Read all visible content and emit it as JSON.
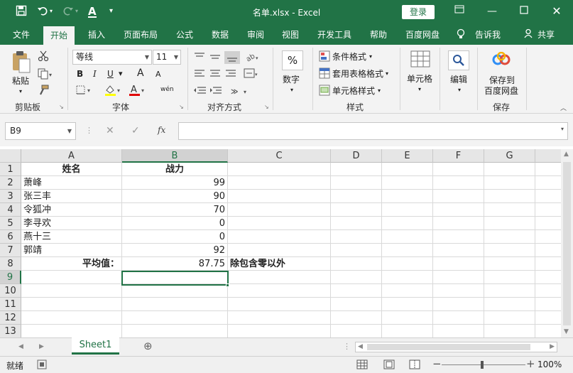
{
  "window": {
    "title": "名单.xlsx  -  Excel",
    "login_label": "登录",
    "accent": "#217346"
  },
  "tabs": [
    {
      "label": "文件"
    },
    {
      "label": "开始"
    },
    {
      "label": "插入"
    },
    {
      "label": "页面布局"
    },
    {
      "label": "公式"
    },
    {
      "label": "数据"
    },
    {
      "label": "审阅"
    },
    {
      "label": "视图"
    },
    {
      "label": "开发工具"
    },
    {
      "label": "帮助"
    },
    {
      "label": "百度网盘"
    },
    {
      "label": "告诉我"
    },
    {
      "label": "共享"
    }
  ],
  "ribbon": {
    "clipboard": {
      "paste": "粘贴",
      "group": "剪贴板"
    },
    "font": {
      "name": "等线",
      "size": "11",
      "group": "字体",
      "bold": "B",
      "italic": "I",
      "underline": "U",
      "grow": "A",
      "shrink": "A",
      "color": "A",
      "phonetic": "wén"
    },
    "alignment": {
      "group": "对齐方式"
    },
    "number": {
      "label": "数字"
    },
    "styles": {
      "cond": "条件格式",
      "table": "套用表格格式",
      "cell": "单元格样式",
      "group": "样式"
    },
    "cells": {
      "label": "单元格"
    },
    "editing": {
      "label": "编辑"
    },
    "save": {
      "line1": "保存到",
      "line2": "百度网盘",
      "group": "保存"
    }
  },
  "formula_bar": {
    "name_box": "B9",
    "fx": "fx",
    "value": ""
  },
  "columns": [
    "A",
    "B",
    "C",
    "D",
    "E",
    "F",
    "G"
  ],
  "rows": [
    "1",
    "2",
    "3",
    "4",
    "5",
    "6",
    "7",
    "8",
    "9",
    "10",
    "11",
    "12",
    "13"
  ],
  "cells": {
    "a1": "姓名",
    "b1": "战力",
    "a2": "萧峰",
    "b2": "99",
    "a3": "张三丰",
    "b3": "90",
    "a4": "令狐冲",
    "b4": "70",
    "a5": "李寻欢",
    "b5": "0",
    "a6": "燕十三",
    "b6": "0",
    "a7": "郭靖",
    "b7": "92",
    "a8": "平均值：",
    "b8": "87.75",
    "c8": "除包含零以外"
  },
  "sheets": [
    {
      "label": "Sheet1"
    }
  ],
  "status": {
    "mode": "就绪",
    "zoom": "100%"
  }
}
